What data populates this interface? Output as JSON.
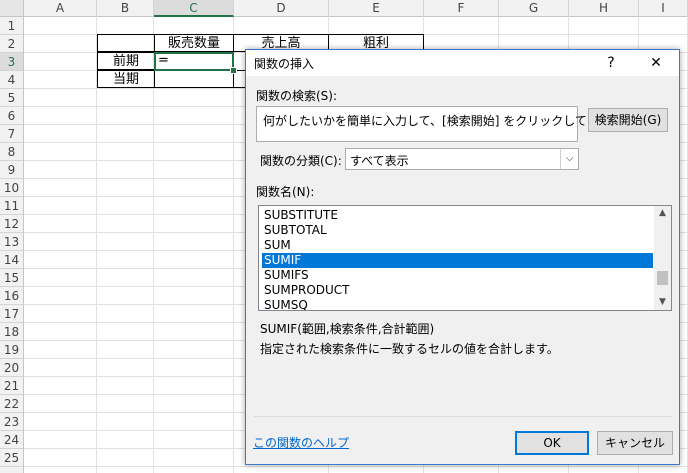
{
  "sheet": {
    "columns": [
      "A",
      "B",
      "C",
      "D",
      "E",
      "F",
      "G",
      "H",
      "I"
    ],
    "rows": [
      "1",
      "2",
      "3",
      "4",
      "5",
      "6",
      "7",
      "8",
      "9",
      "10",
      "11",
      "12",
      "13",
      "14",
      "15",
      "16",
      "17",
      "18",
      "19",
      "20",
      "21",
      "22",
      "23",
      "24",
      "25"
    ],
    "selected_column": "C",
    "selected_row": "3",
    "cells": {
      "C2": "販売数量",
      "D2": "売上高",
      "E2": "粗利",
      "B3": "前期",
      "C3": "=",
      "B4": "当期"
    },
    "accent_color": "#217346"
  },
  "dialog": {
    "title": "関数の挿入",
    "help_glyph": "?",
    "close_glyph": "✕",
    "search_label": "関数の検索(S):",
    "search_value": "何がしたいかを簡単に入力して、[検索開始] をクリックしてください。",
    "search_button": "検索開始(G)",
    "category_label": "関数の分類(C):",
    "category_value": "すべて表示",
    "function_name_label": "関数名(N):",
    "functions": [
      "SUBSTITUTE",
      "SUBTOTAL",
      "SUM",
      "SUMIF",
      "SUMIFS",
      "SUMPRODUCT",
      "SUMSQ"
    ],
    "selected_function": "SUMIF",
    "syntax": "SUMIF(範囲,検索条件,合計範囲)",
    "description": "指定された検索条件に一致するセルの値を合計します。",
    "help_link": "この関数のヘルプ",
    "ok_button": "OK",
    "cancel_button": "キャンセル",
    "selection_color": "#0078d7"
  }
}
